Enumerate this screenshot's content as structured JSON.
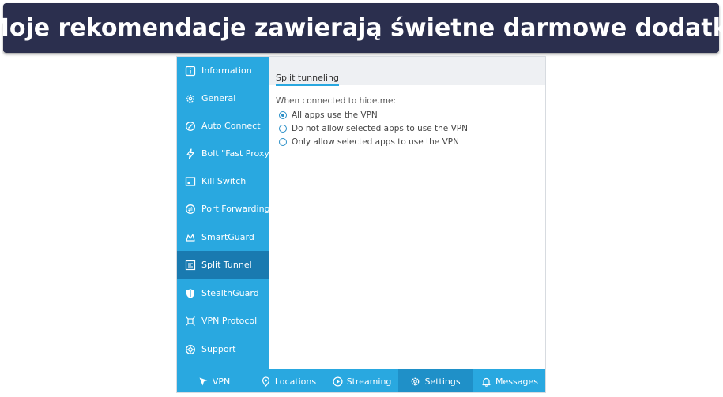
{
  "banner": {
    "text": "Moje rekomendacje zawierają świetne darmowe dodatki"
  },
  "sidebar": {
    "items": [
      {
        "label": "Information",
        "icon": "info-icon"
      },
      {
        "label": "General",
        "icon": "gear-icon"
      },
      {
        "label": "Auto Connect",
        "icon": "link-icon"
      },
      {
        "label": "Bolt \"Fast Proxy\"",
        "icon": "bolt-icon"
      },
      {
        "label": "Kill Switch",
        "icon": "kill-switch-icon"
      },
      {
        "label": "Port Forwarding",
        "icon": "port-forwarding-icon"
      },
      {
        "label": "SmartGuard",
        "icon": "smartguard-icon"
      },
      {
        "label": "Split Tunnel",
        "icon": "split-tunnel-icon",
        "active": true
      },
      {
        "label": "StealthGuard",
        "icon": "shield-icon"
      },
      {
        "label": "VPN Protocol",
        "icon": "protocol-icon"
      },
      {
        "label": "Support",
        "icon": "lifebuoy-icon"
      }
    ]
  },
  "content": {
    "section_tab": "Split tunneling",
    "when_label": "When connected to hide.me:",
    "options": [
      {
        "label": "All apps use the VPN",
        "selected": true
      },
      {
        "label": "Do not allow selected apps to use the VPN",
        "selected": false
      },
      {
        "label": "Only allow selected apps to use the VPN",
        "selected": false
      }
    ]
  },
  "bottombar": {
    "items": [
      {
        "label": "VPN",
        "icon": "vpn-icon"
      },
      {
        "label": "Locations",
        "icon": "location-pin-icon"
      },
      {
        "label": "Streaming",
        "icon": "play-icon"
      },
      {
        "label": "Settings",
        "icon": "gear-icon",
        "active": true
      },
      {
        "label": "Messages",
        "icon": "bell-icon"
      }
    ]
  },
  "colors": {
    "banner_bg": "#2b2f4e",
    "sidebar_bg": "#29a8e0",
    "sidebar_active": "#197ab0",
    "accent": "#29a8e0"
  }
}
